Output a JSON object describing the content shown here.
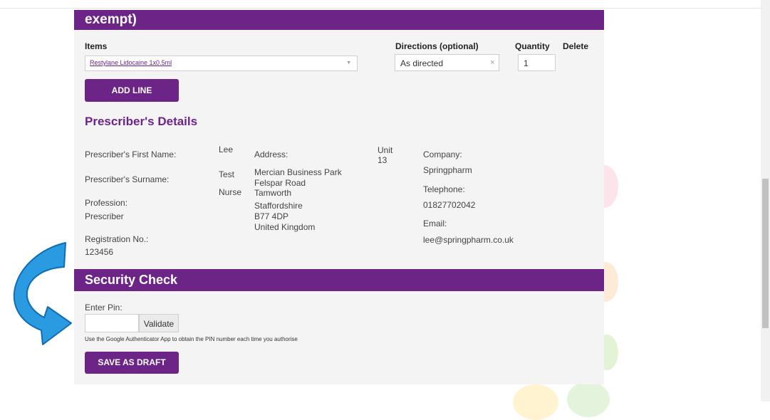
{
  "colors": {
    "brand": "#6c2487",
    "panel": "#f4f4f4",
    "arrow": "#2a9be0"
  },
  "section_header": {
    "title": "exempt)"
  },
  "items_table": {
    "headers": {
      "items": "Items",
      "directions": "Directions (optional)",
      "quantity": "Quantity",
      "delete": "Delete"
    },
    "row": {
      "item": "Restylane Lidocaine 1x0.5ml",
      "directions": "As directed",
      "quantity": "1"
    },
    "add_line_label": "ADD LINE"
  },
  "prescriber": {
    "title": "Prescriber's Details",
    "first_name_label": "Prescriber's First Name:",
    "first_name": "Lee",
    "surname_label": "Prescriber's Surname:",
    "surname": "Test",
    "profession_label": "Profession:",
    "profession_value": "Prescriber",
    "profession_side": "Nurse",
    "registration_label": "Registration No.:",
    "registration": "123456",
    "address_label": "Address:",
    "address_lines": [
      "Mercian Business Park",
      "Felspar Road",
      "Tamworth",
      "Staffordshire",
      "B77 4DP",
      "United Kingdom"
    ],
    "unit_lines": [
      "Unit",
      "13"
    ],
    "company_label": "Company:",
    "company": "Springpharm",
    "telephone_label": "Telephone:",
    "telephone": "01827702042",
    "email_label": "Email:",
    "email": "lee@springpharm.co.uk"
  },
  "security": {
    "title": "Security Check",
    "pin_label": "Enter Pin:",
    "pin_value": "",
    "validate_label": "Validate",
    "hint": "Use the Google Authenticator App to obtain the PIN number each time you authorise",
    "save_draft_label": "SAVE AS DRAFT"
  }
}
